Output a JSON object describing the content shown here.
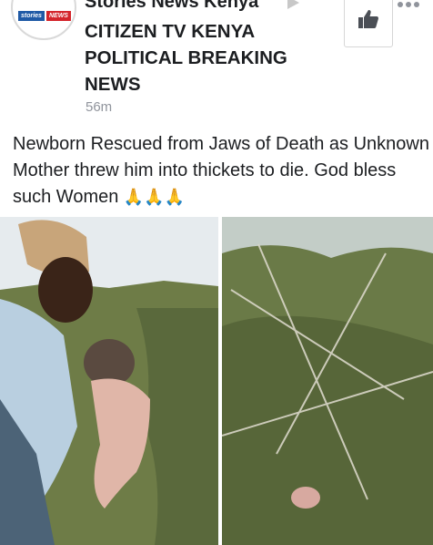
{
  "header": {
    "avatar_logo": {
      "left": "stories",
      "right": "NEWS"
    },
    "page_name": "Stories News Kenya",
    "group_name": "CITIZEN TV KENYA POLITICAL BREAKING NEWS",
    "timestamp": "56m"
  },
  "post": {
    "text": "Newborn Rescued from Jaws of Death as Unknown Mother threw him into thickets to die. God bless such Women",
    "emoji": "🙏🙏🙏"
  },
  "icons": {
    "like": "thumbs-up-icon",
    "more": "more-options-icon",
    "arrow": "shared-to-arrow-icon"
  },
  "colors": {
    "text": "#1c1e21",
    "muted": "#90949c",
    "logo_blue": "#1f5aa6",
    "logo_red": "#d4252b"
  }
}
